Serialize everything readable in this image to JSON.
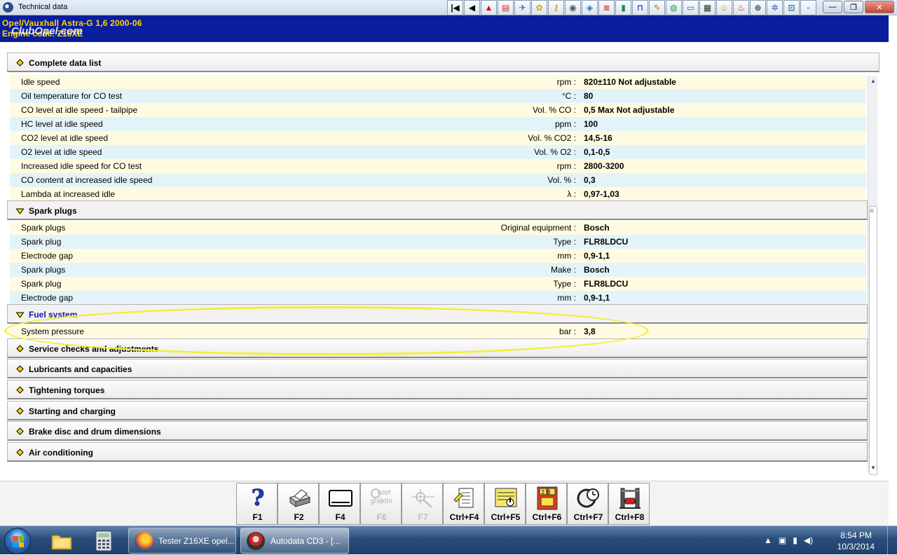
{
  "window": {
    "title": "Technical data",
    "min_icon": "minimize-icon",
    "max_icon": "maximize-icon",
    "close_icon": "close-icon"
  },
  "toolbar": {
    "icons": [
      "first-record-icon",
      "previous-icon",
      "warning-icon",
      "document-icon",
      "tools-icon",
      "parts-icon",
      "key-icon",
      "gauge-icon",
      "diagnostics-icon",
      "fuel-icon",
      "battery-icon",
      "lift-icon",
      "repair-icon",
      "brake-icon",
      "oil-icon",
      "manual-icon",
      "timing-icon",
      "belt-icon",
      "wheel-icon",
      "aircon-icon",
      "car-icon",
      "note-icon"
    ]
  },
  "vehicle": {
    "line1": "Opel/Vauxhall   Astra-G  1,6  2000-06",
    "line2": "Engine code: Z16XE",
    "watermark": "ClubOpel.com"
  },
  "sections": {
    "complete": {
      "label": "Complete data list",
      "arrow": "arrow-icon"
    },
    "spark": {
      "label": "Spark plugs"
    },
    "fuel": {
      "label": "Fuel system"
    },
    "service": {
      "label": "Service checks and adjustments"
    },
    "lubricants": {
      "label": "Lubricants and capacities"
    },
    "torques": {
      "label": "Tightening torques"
    },
    "starting": {
      "label": "Starting and charging"
    },
    "brakes": {
      "label": "Brake disc and drum dimensions"
    },
    "aircon": {
      "label": "Air conditioning"
    }
  },
  "idle_rows": [
    {
      "name": "Idle speed",
      "unit": "rpm :",
      "value": "820±110 Not adjustable"
    },
    {
      "name": "Oil temperature for CO test",
      "unit": "°C :",
      "value": "80"
    },
    {
      "name": "CO level at idle speed - tailpipe",
      "unit": "Vol. % CO :",
      "value": "0,5 Max Not adjustable"
    },
    {
      "name": "HC level at idle speed",
      "unit": "ppm :",
      "value": "100"
    },
    {
      "name": "CO2 level at idle speed",
      "unit": "Vol. % CO2 :",
      "value": "14,5-16"
    },
    {
      "name": "O2 level at idle speed",
      "unit": "Vol. % O2 :",
      "value": "0,1-0,5"
    },
    {
      "name": "Increased idle speed for CO test",
      "unit": "rpm :",
      "value": "2800-3200"
    },
    {
      "name": "CO content at increased idle speed",
      "unit": "Vol. % :",
      "value": "0,3"
    },
    {
      "name": "Lambda at increased idle",
      "unit": "λ :",
      "value": "0,97-1,03"
    }
  ],
  "spark_rows": [
    {
      "name": "Spark plugs",
      "unit": "Original equipment :",
      "value": "Bosch"
    },
    {
      "name": "Spark plug",
      "unit": "Type :",
      "value": "FLR8LDCU"
    },
    {
      "name": "Electrode gap",
      "unit": "mm :",
      "value": "0,9-1,1"
    },
    {
      "name": "Spark plugs",
      "unit": "Make :",
      "value": "Bosch"
    },
    {
      "name": "Spark plug",
      "unit": "Type :",
      "value": "FLR8LDCU"
    },
    {
      "name": "Electrode gap",
      "unit": "mm :",
      "value": "0,9-1,1"
    }
  ],
  "fuel_rows": [
    {
      "name": "System pressure",
      "unit": "bar :",
      "value": "3,8"
    }
  ],
  "fkeys": [
    {
      "label": "F1",
      "icon": "help-icon",
      "enabled": true
    },
    {
      "label": "F2",
      "icon": "print-icon",
      "enabled": true
    },
    {
      "label": "F4",
      "icon": "screen-icon",
      "enabled": true
    },
    {
      "label": "F6",
      "icon": "search-text-icon",
      "enabled": false,
      "icon_text_1": "cdef",
      "icon_text_2": "ghijklm"
    },
    {
      "label": "F7",
      "icon": "crosshair-icon",
      "enabled": false
    },
    {
      "label": "Ctrl+F4",
      "icon": "notes-icon",
      "enabled": true
    },
    {
      "label": "Ctrl+F5",
      "icon": "pointer-list-icon",
      "enabled": true
    },
    {
      "label": "Ctrl+F6",
      "icon": "numbered-grid-icon",
      "enabled": true,
      "icon_text": "23"
    },
    {
      "label": "Ctrl+F7",
      "icon": "timer-icon",
      "enabled": true
    },
    {
      "label": "Ctrl+F8",
      "icon": "vehicle-lift-icon",
      "enabled": true
    }
  ],
  "taskbar": {
    "start_icon": "windows-start-icon",
    "pinned": [
      "file-explorer-icon",
      "calculator-icon"
    ],
    "tasks": [
      {
        "label": "Tester Z16XE opel...",
        "icon": "firefox-icon"
      },
      {
        "label": "Autodata CD3 - [...",
        "icon": "autodata-icon"
      }
    ],
    "time": "8:54 PM",
    "date": "10/3/2014"
  },
  "colors": {
    "header_bg": "#0a1e9c",
    "header_text": "#ffd700",
    "row_yellow": "#fffbe1",
    "row_blue": "#e3f3fa",
    "highlight": "#f2ef3b"
  }
}
